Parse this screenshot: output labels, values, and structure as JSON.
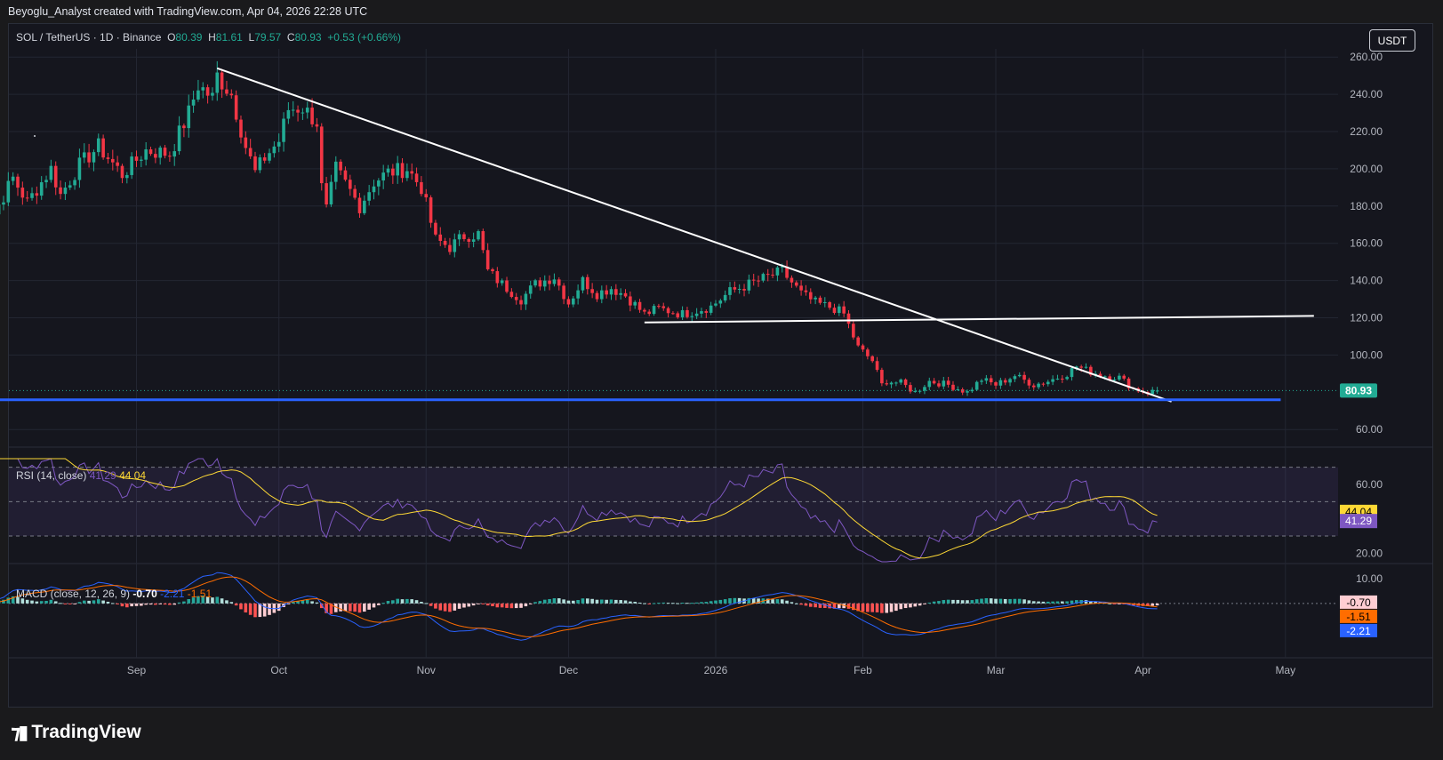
{
  "header": {
    "credit": "Beyoglu_Analyst created with TradingView.com, Apr 04, 2026 22:28 UTC"
  },
  "symbol": {
    "title": "SOL / TetherUS · 1D · Binance",
    "o_label": "O",
    "o_value": "80.39",
    "h_label": "H",
    "h_value": "81.61",
    "l_label": "L",
    "l_value": "79.57",
    "c_label": "C",
    "c_value": "80.93",
    "change": "+0.53 (+0.66%)"
  },
  "currency_button": "USDT",
  "rsi_legend": {
    "label": "RSI (14, close)",
    "rsi": "41.29",
    "ma": "44.04"
  },
  "macd_legend": {
    "label": "MACD (close, 12, 26, 9)",
    "hist": "-0.70",
    "macd": "-2.21",
    "signal": "-1.51"
  },
  "footer": {
    "brand": "TradingView"
  },
  "colors": {
    "up": "#22ab94",
    "down": "#f23645",
    "trendline": "#ffffff",
    "support": "#2962ff",
    "rsi": "#7e57c2",
    "rsi_ma": "#fdd835",
    "macd": "#2962ff",
    "signal": "#ff6d00",
    "background": "#15161e",
    "grid": "#232632"
  },
  "chart_data": [
    {
      "type": "candlestick",
      "y_ticks": [
        "260.00",
        "240.00",
        "220.00",
        "200.00",
        "180.00",
        "160.00",
        "140.00",
        "120.00",
        "100.00",
        "80.93",
        "60.00"
      ],
      "ylim": [
        52,
        262
      ],
      "x_labels": [
        "Sep",
        "Oct",
        "Nov",
        "Dec",
        "2026",
        "Feb",
        "Mar",
        "Apr",
        "May"
      ],
      "last_price": 80.93,
      "lines": [
        {
          "name": "descending trendline",
          "from": [
            "2025-09-18",
            254
          ],
          "to": [
            "2026-04-07",
            75
          ]
        },
        {
          "name": "horizontal level",
          "from": [
            "2025-12-17",
            117.5
          ],
          "to": [
            "2026-05-07",
            121
          ]
        },
        {
          "name": "support",
          "from": [
            "2025-07-29",
            76
          ],
          "to": [
            "2026-04-30",
            76
          ]
        }
      ],
      "close_anchors": [
        [
          "2025-07-29",
          168
        ],
        [
          "2025-08-02",
          176
        ],
        [
          "2025-08-06",
          195
        ],
        [
          "2025-08-09",
          182
        ],
        [
          "2025-08-14",
          200
        ],
        [
          "2025-08-16",
          186
        ],
        [
          "2025-08-20",
          202
        ],
        [
          "2025-08-24",
          212
        ],
        [
          "2025-08-29",
          197
        ],
        [
          "2025-09-03",
          210
        ],
        [
          "2025-09-08",
          208
        ],
        [
          "2025-09-12",
          230
        ],
        [
          "2025-09-14",
          245
        ],
        [
          "2025-09-17",
          238
        ],
        [
          "2025-09-18",
          250
        ],
        [
          "2025-09-21",
          240
        ],
        [
          "2025-09-24",
          212
        ],
        [
          "2025-09-26",
          198
        ],
        [
          "2025-09-28",
          206
        ],
        [
          "2025-10-01",
          215
        ],
        [
          "2025-10-03",
          232
        ],
        [
          "2025-10-06",
          233
        ],
        [
          "2025-10-09",
          225
        ],
        [
          "2025-10-10",
          190
        ],
        [
          "2025-10-11",
          178
        ],
        [
          "2025-10-13",
          200
        ],
        [
          "2025-10-16",
          188
        ],
        [
          "2025-10-18",
          180
        ],
        [
          "2025-10-21",
          193
        ],
        [
          "2025-10-24",
          198
        ],
        [
          "2025-10-28",
          200
        ],
        [
          "2025-10-31",
          190
        ],
        [
          "2025-11-03",
          162
        ],
        [
          "2025-11-06",
          158
        ],
        [
          "2025-11-09",
          164
        ],
        [
          "2025-11-12",
          165
        ],
        [
          "2025-11-14",
          145
        ],
        [
          "2025-11-17",
          138
        ],
        [
          "2025-11-21",
          130
        ],
        [
          "2025-11-24",
          138
        ],
        [
          "2025-11-28",
          142
        ],
        [
          "2025-12-01",
          128
        ],
        [
          "2025-12-04",
          140
        ],
        [
          "2025-12-07",
          133
        ],
        [
          "2025-12-10",
          136
        ],
        [
          "2025-12-13",
          132
        ],
        [
          "2025-12-17",
          122
        ],
        [
          "2025-12-20",
          125
        ],
        [
          "2025-12-25",
          122
        ],
        [
          "2025-12-31",
          126
        ],
        [
          "2026-01-04",
          134
        ],
        [
          "2026-01-08",
          138
        ],
        [
          "2026-01-12",
          142
        ],
        [
          "2026-01-15",
          145
        ],
        [
          "2026-01-19",
          133
        ],
        [
          "2026-01-22",
          128
        ],
        [
          "2026-01-26",
          125
        ],
        [
          "2026-01-28",
          122
        ],
        [
          "2026-01-31",
          104
        ],
        [
          "2026-02-03",
          97
        ],
        [
          "2026-02-05",
          84
        ],
        [
          "2026-02-06",
          86
        ],
        [
          "2026-02-09",
          85
        ],
        [
          "2026-02-12",
          80
        ],
        [
          "2026-02-15",
          86
        ],
        [
          "2026-02-19",
          84
        ],
        [
          "2026-02-23",
          80
        ],
        [
          "2026-02-26",
          87
        ],
        [
          "2026-03-01",
          84
        ],
        [
          "2026-03-05",
          89
        ],
        [
          "2026-03-09",
          84
        ],
        [
          "2026-03-12",
          86
        ],
        [
          "2026-03-16",
          90
        ],
        [
          "2026-03-18",
          94
        ],
        [
          "2026-03-21",
          91
        ],
        [
          "2026-03-24",
          89
        ],
        [
          "2026-03-27",
          88
        ],
        [
          "2026-03-30",
          82
        ],
        [
          "2026-04-02",
          80
        ],
        [
          "2026-04-04",
          80.93
        ]
      ]
    },
    {
      "type": "line",
      "name": "RSI (14, close)",
      "y_ticks": [
        "60.00",
        "20.00"
      ],
      "ylim": [
        15,
        75
      ],
      "bands": [
        30,
        50,
        70
      ],
      "last_values": {
        "rsi": 41.29,
        "ma": 44.04
      }
    },
    {
      "type": "bar",
      "name": "MACD (close, 12, 26, 9)",
      "y_ticks": [
        "10.00"
      ],
      "ylim": [
        -22,
        14
      ],
      "last_values": {
        "histogram": -0.7,
        "signal": -1.51,
        "macd": -2.21
      }
    }
  ]
}
